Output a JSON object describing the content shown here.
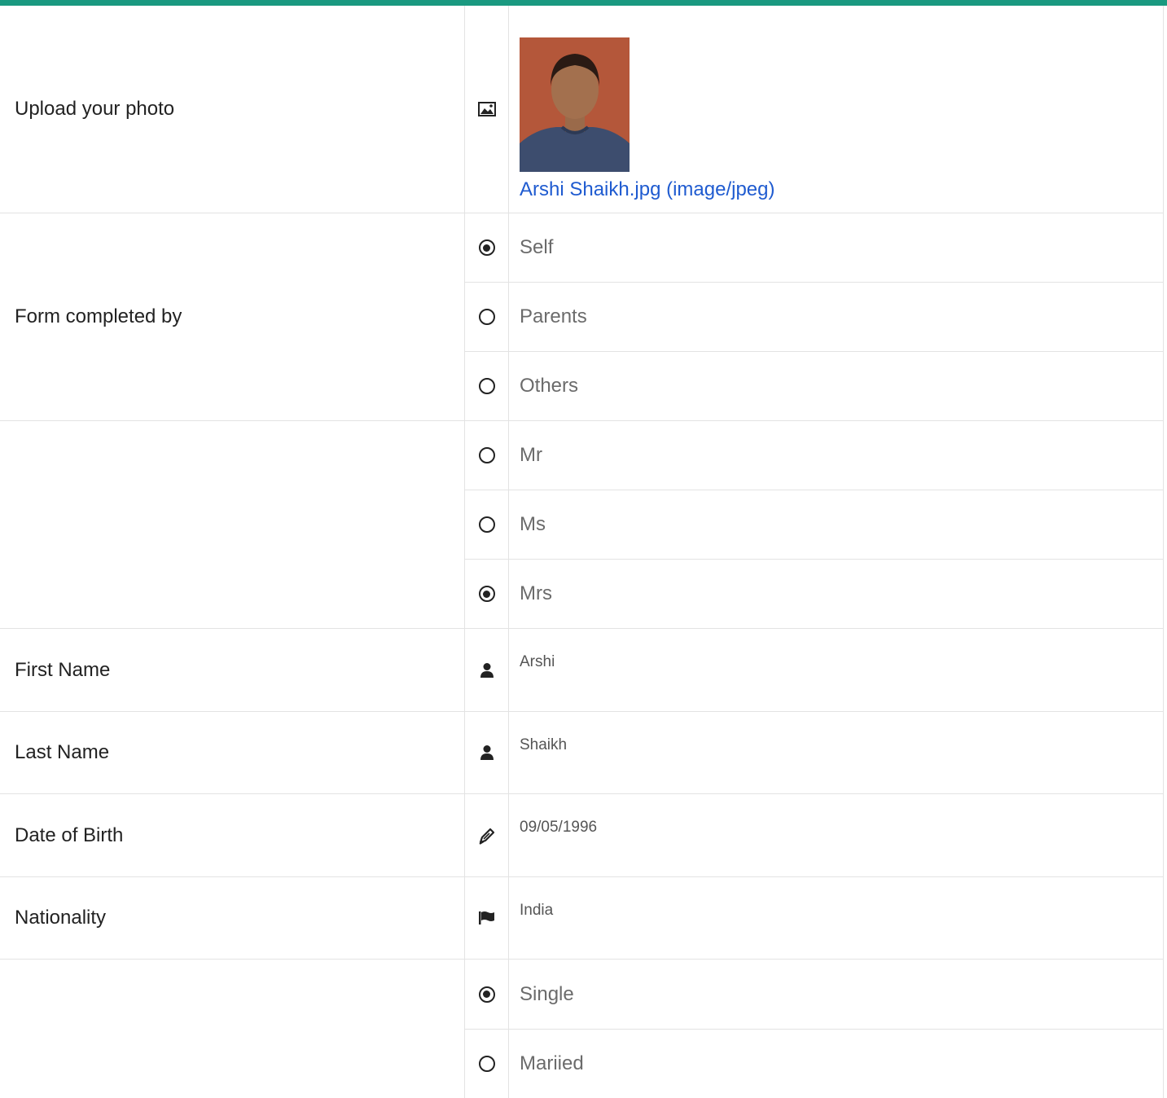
{
  "upload": {
    "label": "Upload your photo",
    "file_link": "Arshi Shaikh.jpg (image/jpeg)"
  },
  "completed_by": {
    "label": "Form completed by",
    "options": [
      {
        "label": "Self",
        "selected": true
      },
      {
        "label": "Parents",
        "selected": false
      },
      {
        "label": "Others",
        "selected": false
      }
    ]
  },
  "title": {
    "label": "",
    "options": [
      {
        "label": "Mr",
        "selected": false
      },
      {
        "label": "Ms",
        "selected": false
      },
      {
        "label": "Mrs",
        "selected": true
      }
    ]
  },
  "first_name": {
    "label": "First Name",
    "value": "Arshi",
    "icon": "user-icon"
  },
  "last_name": {
    "label": "Last Name",
    "value": "Shaikh",
    "icon": "user-icon"
  },
  "dob": {
    "label": "Date of Birth",
    "value": "09/05/1996",
    "icon": "pen-icon"
  },
  "nationality": {
    "label": "Nationality",
    "value": "India",
    "icon": "flag-icon"
  },
  "marital": {
    "label": "",
    "options": [
      {
        "label": "Single",
        "selected": true
      },
      {
        "label": "Mariied",
        "selected": false
      }
    ]
  },
  "colors": {
    "accent": "#1a9980",
    "link": "#1f5bd0",
    "border": "#e3e3e3"
  }
}
